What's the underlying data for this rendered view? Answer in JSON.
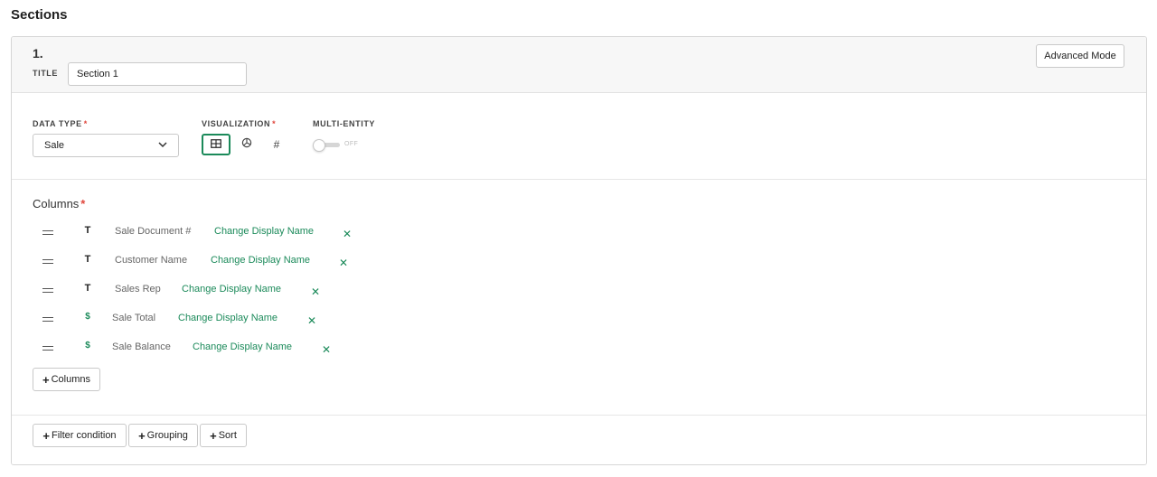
{
  "page": {
    "title": "Sections"
  },
  "section": {
    "number": "1.",
    "title_label": "TITLE",
    "title_value": "Section 1",
    "advanced_mode_label": "Advanced Mode"
  },
  "config": {
    "data_type_label": "DATA TYPE",
    "data_type_value": "Sale",
    "visualization_label": "VISUALIZATION",
    "visualization_options": [
      "table-icon",
      "pie-chart-icon",
      "number-icon"
    ],
    "visualization_selected": "table-icon",
    "multi_entity_label": "MULTI-ENTITY",
    "multi_entity_state": "OFF",
    "required_marker": "*"
  },
  "columns": {
    "heading": "Columns",
    "items": [
      {
        "type_icon": "T",
        "name": "Sale Document #",
        "link": "Change Display Name"
      },
      {
        "type_icon": "T",
        "name": "Customer Name",
        "link": "Change Display Name"
      },
      {
        "type_icon": "T",
        "name": "Sales Rep",
        "link": "Change Display Name"
      },
      {
        "type_icon": "$",
        "name": "Sale Total",
        "link": "Change Display Name"
      },
      {
        "type_icon": "$",
        "name": "Sale Balance",
        "link": "Change Display Name"
      }
    ],
    "add_label": "Columns"
  },
  "footer": {
    "filter_label": "Filter condition",
    "grouping_label": "Grouping",
    "sort_label": "Sort"
  },
  "colors": {
    "accent": "#1b8a5a",
    "required": "#e0473d",
    "border": "#c9c9c9"
  }
}
